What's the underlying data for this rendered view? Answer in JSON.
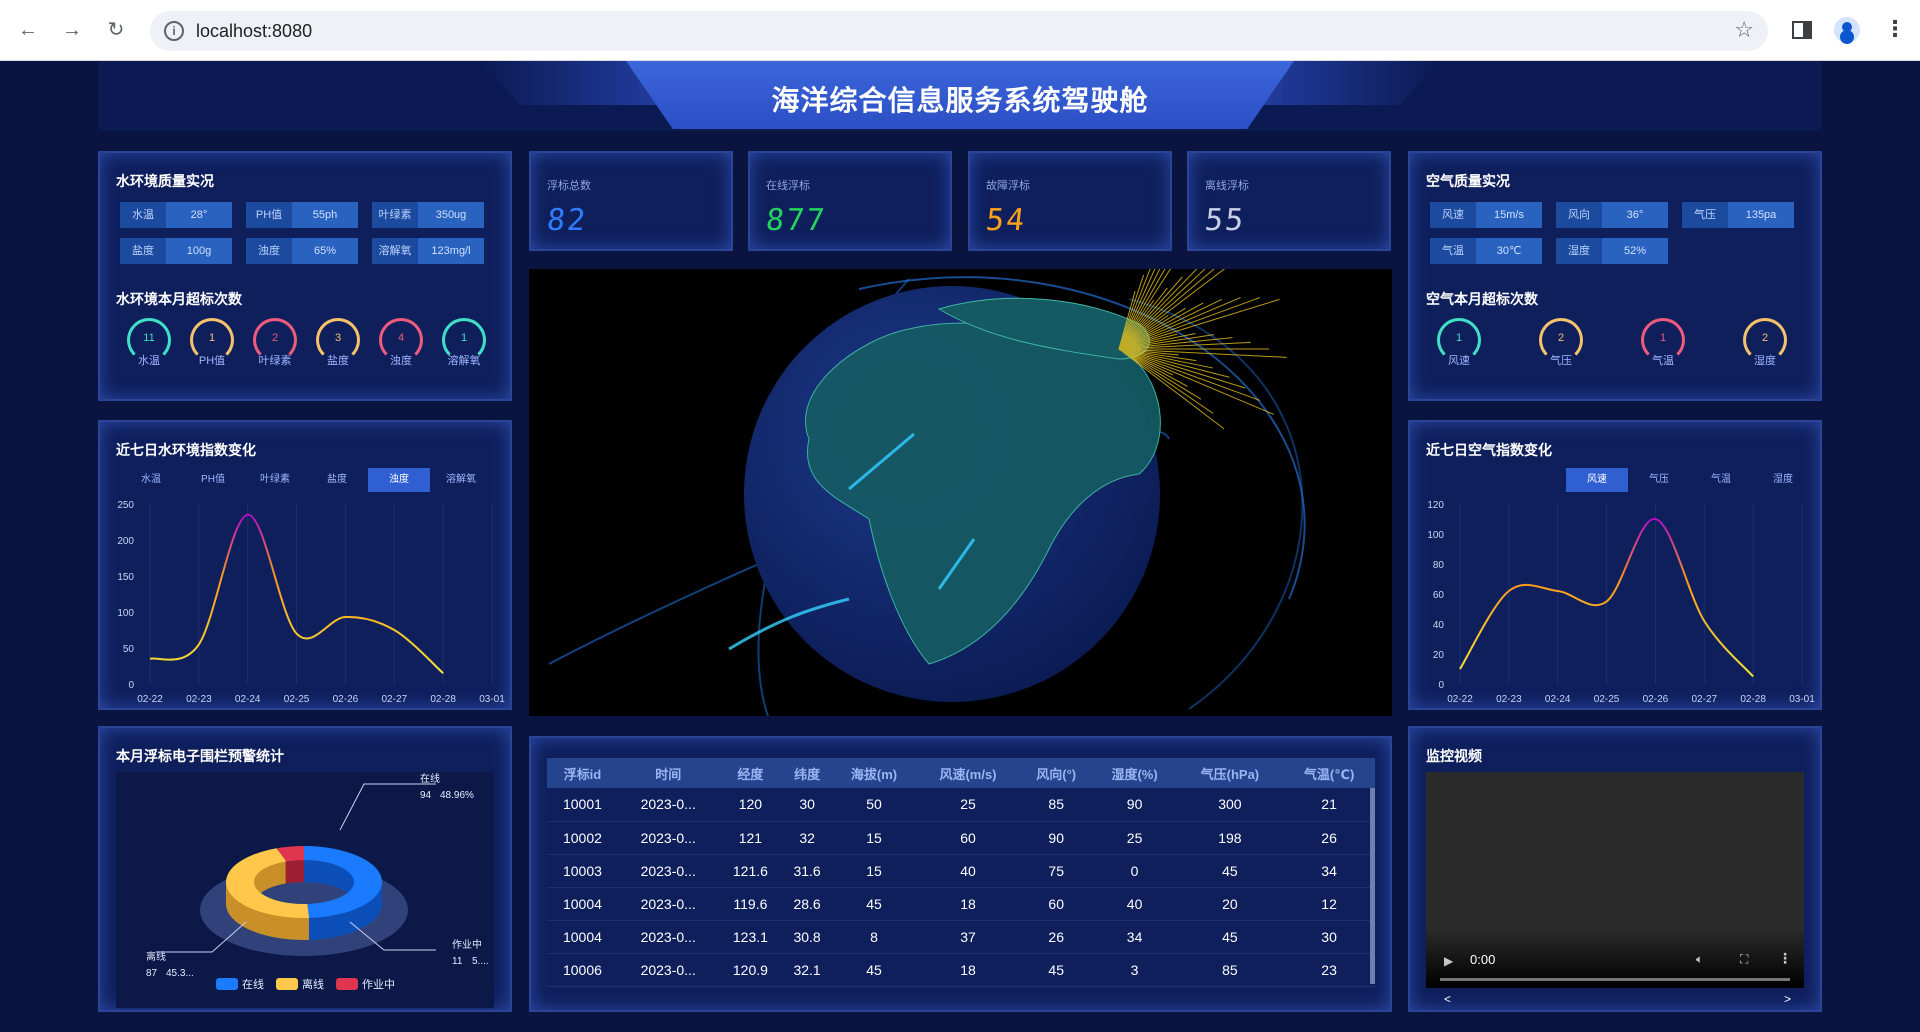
{
  "browser": {
    "url": "localhost:8080",
    "back_icon": "arrow-left-icon",
    "forward_icon": "arrow-right-icon",
    "reload_icon": "reload-icon"
  },
  "header": {
    "title": "海洋综合信息服务系统驾驶舱"
  },
  "water_quality": {
    "title": "水环境质量实况",
    "items": [
      {
        "label": "水温",
        "value": "28°"
      },
      {
        "label": "PH值",
        "value": "55ph"
      },
      {
        "label": "叶绿素",
        "value": "350ug"
      },
      {
        "label": "盐度",
        "value": "100g"
      },
      {
        "label": "浊度",
        "value": "65%"
      },
      {
        "label": "溶解氧",
        "value": "123mg/l"
      }
    ],
    "exceed_title": "水环境本月超标次数",
    "exceed": [
      {
        "label": "水温",
        "value": "11",
        "color": "#3fe0c5"
      },
      {
        "label": "PH值",
        "value": "1",
        "color": "#f6c26b"
      },
      {
        "label": "叶绿素",
        "value": "2",
        "color": "#ef5b7c"
      },
      {
        "label": "盐度",
        "value": "3",
        "color": "#f6c26b"
      },
      {
        "label": "浊度",
        "value": "4",
        "color": "#ef5b7c"
      },
      {
        "label": "溶解氧",
        "value": "1",
        "color": "#3fe0c5"
      }
    ]
  },
  "stats": [
    {
      "label": "浮标总数",
      "value": "82",
      "color": "#2f7dff"
    },
    {
      "label": "在线浮标",
      "value": "877",
      "color": "#22d35c"
    },
    {
      "label": "故障浮标",
      "value": "54",
      "color": "#ffa11a"
    },
    {
      "label": "离线浮标",
      "value": "55",
      "color": "#c7d0e8"
    }
  ],
  "air_quality": {
    "title": "空气质量实况",
    "items": [
      {
        "label": "风速",
        "value": "15m/s"
      },
      {
        "label": "风向",
        "value": "36°"
      },
      {
        "label": "气压",
        "value": "135pa"
      },
      {
        "label": "气温",
        "value": "30℃"
      },
      {
        "label": "湿度",
        "value": "52%"
      }
    ],
    "exceed_title": "空气本月超标次数",
    "exceed": [
      {
        "label": "风速",
        "value": "1",
        "color": "#3fe0c5"
      },
      {
        "label": "气压",
        "value": "2",
        "color": "#f6c26b"
      },
      {
        "label": "气温",
        "value": "1",
        "color": "#ef5b7c"
      },
      {
        "label": "湿度",
        "value": "2",
        "color": "#f6c26b"
      }
    ]
  },
  "water_trend": {
    "title": "近七日水环境指数变化",
    "tabs": [
      "水温",
      "PH值",
      "叶绿素",
      "盐度",
      "浊度",
      "溶解氧"
    ],
    "active_tab": 4
  },
  "air_trend": {
    "title": "近七日空气指数变化",
    "tabs": [
      "风速",
      "气压",
      "气温",
      "湿度"
    ],
    "active_tab": 0
  },
  "fence": {
    "title": "本月浮标电子围栏预警统计"
  },
  "table": {
    "headers": [
      "浮标id",
      "时间",
      "经度",
      "纬度",
      "海拔(m)",
      "风速(m/s)",
      "风向(°)",
      "湿度(%)",
      "气压(hPa)",
      "气温(℃)"
    ],
    "rows": [
      [
        "10001",
        "2023-0...",
        "120",
        "30",
        "50",
        "25",
        "85",
        "90",
        "300",
        "21"
      ],
      [
        "10002",
        "2023-0...",
        "121",
        "32",
        "15",
        "60",
        "90",
        "25",
        "198",
        "26"
      ],
      [
        "10003",
        "2023-0...",
        "121.6",
        "31.6",
        "15",
        "40",
        "75",
        "0",
        "45",
        "34"
      ],
      [
        "10004",
        "2023-0...",
        "119.6",
        "28.6",
        "45",
        "18",
        "60",
        "40",
        "20",
        "12"
      ],
      [
        "10004",
        "2023-0...",
        "123.1",
        "30.8",
        "8",
        "37",
        "26",
        "34",
        "45",
        "30"
      ],
      [
        "10006",
        "2023-0...",
        "120.9",
        "32.1",
        "45",
        "18",
        "45",
        "3",
        "85",
        "23"
      ]
    ]
  },
  "video": {
    "title": "监控视频",
    "time": "0:00",
    "prev": "<",
    "next": ">"
  },
  "chart_data": [
    {
      "type": "line",
      "title": "近七日水环境指数变化",
      "categories": [
        "02-22",
        "02-23",
        "02-24",
        "02-25",
        "02-26",
        "02-27",
        "02-28",
        "03-01"
      ],
      "series": [
        {
          "values": [
            35,
            55,
            235,
            70,
            93,
            75,
            15
          ]
        }
      ],
      "ylim": [
        0,
        250
      ],
      "yticks": [
        0,
        50,
        100,
        150,
        200,
        250
      ],
      "grid": true
    },
    {
      "type": "line",
      "title": "近七日空气指数变化",
      "categories": [
        "02-22",
        "02-23",
        "02-24",
        "02-25",
        "02-26",
        "02-27",
        "02-28",
        "03-01"
      ],
      "series": [
        {
          "values": [
            10,
            62,
            62,
            55,
            110,
            42,
            5
          ]
        }
      ],
      "ylim": [
        0,
        120
      ],
      "yticks": [
        0,
        20,
        40,
        60,
        80,
        100,
        120
      ],
      "grid": true
    },
    {
      "type": "pie",
      "title": "本月浮标电子围栏预警统计",
      "series": [
        {
          "name": "在线",
          "value": 94,
          "label_value": "94",
          "label_percent": "48.96%",
          "color": "#1a7bff"
        },
        {
          "name": "离线",
          "value": 87,
          "label_value": "87",
          "label_percent": "45.3...",
          "color": "#ffc84a"
        },
        {
          "name": "作业中",
          "value": 11,
          "label_value": "11",
          "label_percent": "5....",
          "color": "#e0354f"
        }
      ],
      "legend_placement": "bottom"
    }
  ]
}
